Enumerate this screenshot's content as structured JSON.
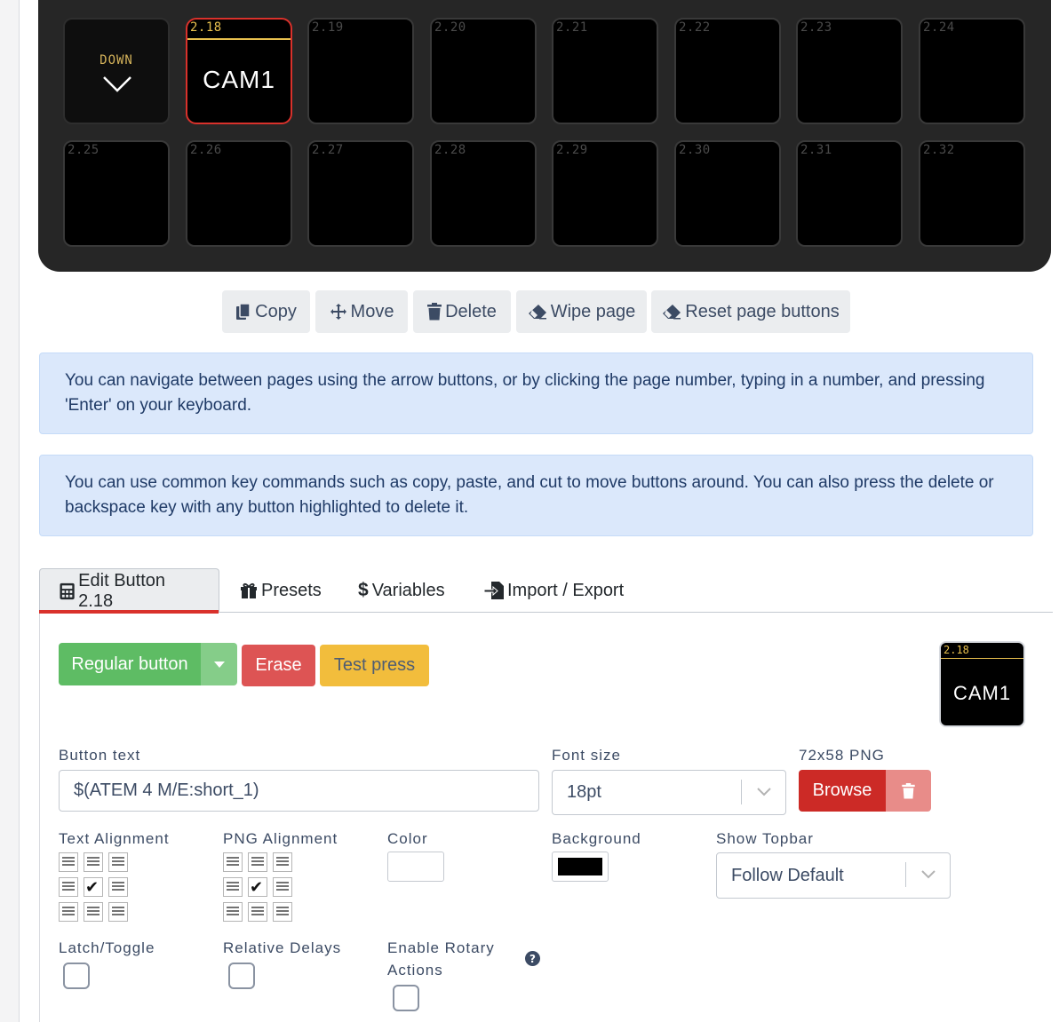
{
  "grid": {
    "nav_label": "DOWN",
    "selected_text": "CAM1",
    "buttons_row1": [
      "2.18",
      "2.19",
      "2.20",
      "2.21",
      "2.22",
      "2.23",
      "2.24"
    ],
    "buttons_row2": [
      "2.25",
      "2.26",
      "2.27",
      "2.28",
      "2.29",
      "2.30",
      "2.31",
      "2.32"
    ]
  },
  "toolbar": {
    "copy": "Copy",
    "move": "Move",
    "delete": "Delete",
    "wipe": "Wipe page",
    "reset": "Reset page buttons"
  },
  "alerts": {
    "nav_hint": "You can navigate between pages using the arrow buttons, or by clicking the page number, typing in a number, and pressing 'Enter' on your keyboard.",
    "key_hint": "You can use common key commands such as copy, paste, and cut to move buttons around. You can also press the delete or backspace key with any button highlighted to delete it."
  },
  "tabs": {
    "edit": "Edit Button 2.18",
    "presets": "Presets",
    "variables": "Variables",
    "import_export": "Import / Export"
  },
  "editor": {
    "type_button": "Regular button",
    "erase": "Erase",
    "test_press": "Test press",
    "button_text_label": "Button text",
    "button_text_value": "$(ATEM 4 M/E:short_1)",
    "font_size_label": "Font size",
    "font_size_value": "18pt",
    "png_label": "72x58 PNG",
    "browse": "Browse",
    "text_alignment_label": "Text Alignment",
    "png_alignment_label": "PNG Alignment",
    "color_label": "Color",
    "background_label": "Background",
    "show_topbar_label": "Show Topbar",
    "show_topbar_value": "Follow Default",
    "latch_label": "Latch/Toggle",
    "relative_delays_label": "Relative Delays",
    "rotary_label_1": "Enable Rotary",
    "rotary_label_2": "Actions",
    "preview_number": "2.18",
    "preview_text": "CAM1"
  },
  "colors": {
    "success": "#5ebc64",
    "danger": "#dd5454",
    "warning": "#f2bd3c",
    "browse": "#cc2a26",
    "accent_red": "#d9312b",
    "topbar_yellow": "#e8c04e",
    "text_color_swatch": "#ffffff",
    "background_swatch": "#000000"
  }
}
